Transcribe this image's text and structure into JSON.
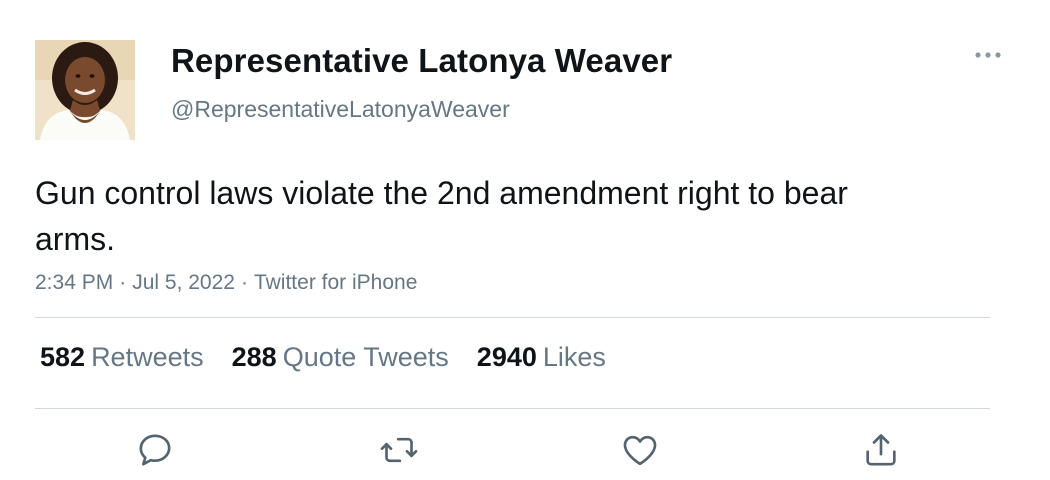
{
  "user": {
    "display_name": "Representative Latonya Weaver",
    "handle": "@RepresentativeLatonyaWeaver",
    "avatar": "profile-photo"
  },
  "tweet": {
    "text": "Gun control laws violate the 2nd amendment right to bear arms.",
    "time": "2:34 PM",
    "date": "Jul 5, 2022",
    "source": "Twitter for iPhone",
    "separator": "·"
  },
  "stats": {
    "retweets": {
      "count": "582",
      "label": "Retweets"
    },
    "quote_tweets": {
      "count": "288",
      "label": "Quote Tweets"
    },
    "likes": {
      "count": "2940",
      "label": "Likes"
    }
  },
  "actions": [
    "reply-icon",
    "retweet-icon",
    "like-icon",
    "share-icon"
  ],
  "colors": {
    "text": "#0f1419",
    "secondary": "#657786",
    "divider": "#cfd9de",
    "icon": "#536471"
  }
}
